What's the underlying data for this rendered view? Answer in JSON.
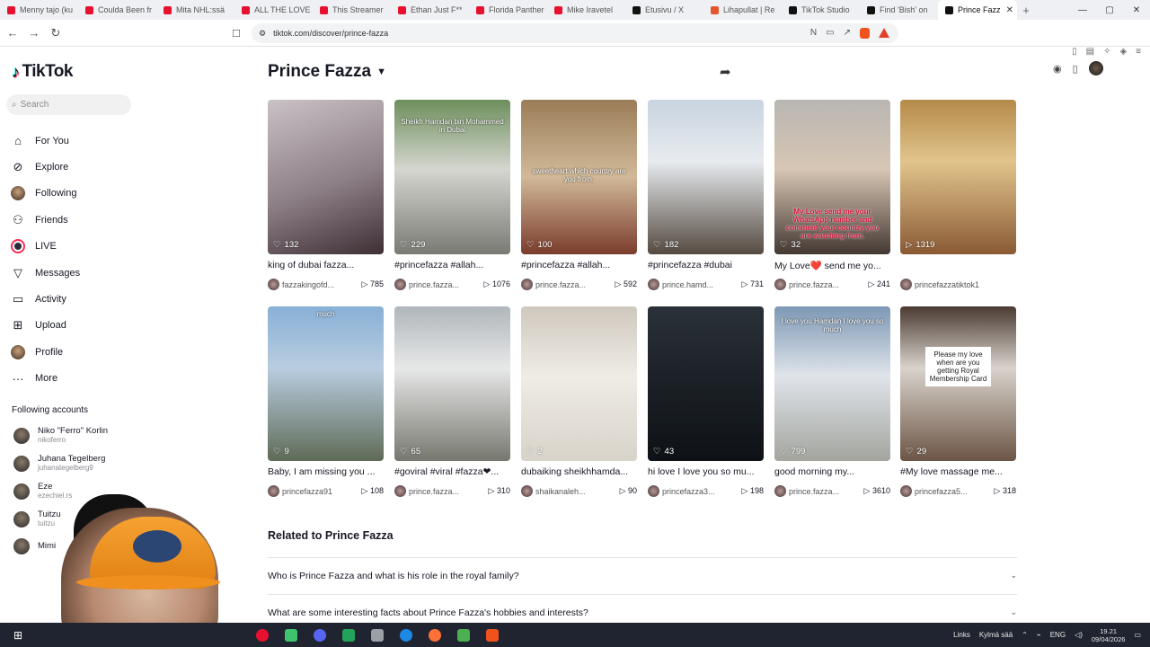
{
  "browser": {
    "tabs": [
      {
        "title": "Menny tajo (ku",
        "color": "#e8102f"
      },
      {
        "title": "Coulda Been fr",
        "color": "#e8102f"
      },
      {
        "title": "Mita NHL:ssä",
        "color": "#e8102f"
      },
      {
        "title": "ALL THE LOVE",
        "color": "#e8102f"
      },
      {
        "title": "This Streamer",
        "color": "#e8102f"
      },
      {
        "title": "Ethan Just F**",
        "color": "#e8102f"
      },
      {
        "title": "Florida Panther",
        "color": "#e8102f"
      },
      {
        "title": "Mike Iravetel",
        "color": "#e8102f"
      },
      {
        "title": "Etusivu / X",
        "color": "#111111"
      },
      {
        "title": "Lihapullat | Re",
        "color": "#e5552c"
      },
      {
        "title": "TikTok Studio",
        "color": "#111111"
      },
      {
        "title": "Find 'Bish' on",
        "color": "#111111"
      },
      {
        "title": "Prince Fazz",
        "color": "#111111",
        "active": true
      }
    ],
    "url": "tiktok.com/discover/prince-fazza"
  },
  "sidebar": {
    "brand": "TikTok",
    "search_placeholder": "Search",
    "nav": [
      {
        "label": "For You",
        "icon": "home-icon"
      },
      {
        "label": "Explore",
        "icon": "compass-icon"
      },
      {
        "label": "Following",
        "icon": "avatar"
      },
      {
        "label": "Friends",
        "icon": "friends-icon"
      },
      {
        "label": "LIVE",
        "icon": "live-icon"
      },
      {
        "label": "Messages",
        "icon": "messages-icon"
      },
      {
        "label": "Activity",
        "icon": "activity-icon"
      },
      {
        "label": "Upload",
        "icon": "upload-icon"
      },
      {
        "label": "Profile",
        "icon": "profile-icon"
      },
      {
        "label": "More",
        "icon": "more-icon"
      }
    ],
    "following_title": "Following accounts",
    "following": [
      {
        "name": "Niko \"Ferro\" Korlin",
        "handle": "nikoferro"
      },
      {
        "name": "Juhana Tegelberg",
        "handle": "juhanategelberg9"
      },
      {
        "name": "Eze",
        "handle": "ezechiel.rs"
      },
      {
        "name": "Tuitzu",
        "handle": "tuitzu"
      },
      {
        "name": "Mimi",
        "handle": ""
      }
    ]
  },
  "page": {
    "title": "Prince Fazza",
    "related_title": "Related to Prince Fazza",
    "faqs": [
      "Who is Prince Fazza and what is his role in the royal family?",
      "What are some interesting facts about Prince Fazza's hobbies and interests?"
    ]
  },
  "videos": [
    {
      "likes": "132",
      "caption": "king of dubai fazza...",
      "user": "fazzakingofd...",
      "views": "785",
      "overlay": "",
      "bg": "linear-gradient(160deg,#c9c2c6,#8d7f86 55%,#3d2f34)"
    },
    {
      "likes": "229",
      "caption": "#princefazza #allah...",
      "user": "prince.fazza...",
      "views": "1076",
      "overlay": "Sheikh Hamdan bin Mohammed in Dubai",
      "bg": "linear-gradient(180deg,#6d8f5c,#d5d6cf 45%,#7a7a74)"
    },
    {
      "likes": "100",
      "caption": "#princefazza #allah...",
      "user": "prince.fazza...",
      "views": "592",
      "overlay": "sweetheart which country are you from.",
      "bg": "linear-gradient(180deg,#9a7d57,#d1b998 50%,#7b3c2c)"
    },
    {
      "likes": "182",
      "caption": "#princefazza #dubai",
      "user": "prince.hamd...",
      "views": "731",
      "overlay": "",
      "bg": "linear-gradient(180deg,#c8d4e0,#e7ebef 40%,#554a40)"
    },
    {
      "likes": "32",
      "caption": "My Love❤️ send me yo...",
      "user": "prince.fazza...",
      "views": "241",
      "overlay": "My Love send me your WhatsApp number and comment your country you are watching from.",
      "bg": "linear-gradient(180deg,#b9b6b2,#d7c6b4 45%,#443832)"
    },
    {
      "likes": "1319",
      "caption": "",
      "user": "princefazzatiktok1",
      "views": "",
      "overlay": "",
      "bg": "linear-gradient(180deg,#b58a4a,#e1c48c 40%,#8a5a35)",
      "playcount": true
    },
    {
      "likes": "9",
      "caption": "Baby, I am missing you ...",
      "user": "princefazza91",
      "views": "108",
      "overlay": "much",
      "bg": "linear-gradient(180deg,#88b0d6,#b9cde0 40%,#5f6b57)"
    },
    {
      "likes": "65",
      "caption": "#goviral #viral #fazza❤...",
      "user": "prince.fazza...",
      "views": "310",
      "overlay": "",
      "bg": "linear-gradient(180deg,#b0b6bb,#e7e8e8 40%,#76786f)"
    },
    {
      "likes": "2",
      "caption": "dubaiking sheikhhamda...",
      "user": "shaikanaleh...",
      "views": "90",
      "overlay": "",
      "bg": "linear-gradient(180deg,#cfc8bd,#efece6 45%,#d8d3c9)"
    },
    {
      "likes": "43",
      "caption": "hi love I love you so mu...",
      "user": "princefazza3...",
      "views": "198",
      "overlay": "",
      "bg": "linear-gradient(180deg,#2a3138,#1b2026 50%,#0e1217)"
    },
    {
      "likes": "799",
      "caption": "good morning my...",
      "user": "prince.fazza...",
      "views": "3610",
      "overlay": "I love you Hamdan I love you so much",
      "bg": "linear-gradient(180deg,#7d98b5,#dfe4ea 45%,#a3a59e)"
    },
    {
      "likes": "29",
      "caption": "#My love massage me...",
      "user": "princefazza5...",
      "views": "318",
      "overlay": "Please my love when are you getting Royal Membership Card",
      "bg": "linear-gradient(180deg,#4a3a32,#d9d3cc 40%,#6c5545)"
    }
  ],
  "taskbar": {
    "links_label": "Links",
    "weather": "Kylmä sää",
    "lang": "ENG",
    "time": "19.21",
    "date": "09/04/2026",
    "apps": [
      "#e8102f",
      "#3ec46d",
      "#5865f2",
      "#22a35a",
      "#9aa0a6",
      "#1e88e5",
      "#ff7139",
      "#4caf50",
      "#f0521c"
    ]
  }
}
